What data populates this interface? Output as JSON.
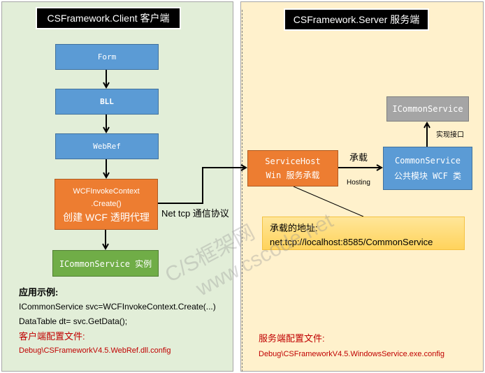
{
  "client": {
    "title": "CSFramework.Client 客户端",
    "boxes": {
      "form": "Form",
      "bll": "BLL",
      "webref": "WebRef",
      "wcf_line1": "WCFInvokeContext",
      "wcf_line2": ".Create()",
      "wcf_line3": "创建 WCF 透明代理",
      "instance": "ICommonService 实例"
    },
    "notes": {
      "heading": "应用示例:",
      "code_line1": "ICommonService svc=WCFInvokeContext.Create(...)",
      "code_line2": "DataTable dt= svc.GetData();",
      "config_heading": "客户端配置文件:",
      "config_path": "Debug\\CSFrameworkV4.5.WebRef.dll.config"
    }
  },
  "server": {
    "title": "CSFramework.Server 服务端",
    "boxes": {
      "servicehost_line1": "ServiceHost",
      "servicehost_line2": "Win 服务承载",
      "commonservice_line1": "CommonService",
      "commonservice_line2": "公共模块 WCF 类",
      "icommon": "ICommonService"
    },
    "address": {
      "heading": "承载的地址:",
      "url": "net.tcp://localhost:8585/CommonService"
    },
    "notes": {
      "config_heading": "服务端配置文件:",
      "config_path": "Debug\\CSFrameworkV4.5.WindowsService.exe.config"
    }
  },
  "connectors": {
    "protocol_label": "Net tcp 通信协议",
    "hosting_label_cn": "承载",
    "hosting_label_en": "Hosting",
    "implements_label": "实现接口"
  },
  "watermark": {
    "line1": "C/S框架网",
    "line2": "www.cscode.net"
  },
  "colors": {
    "client_bg": "#e2eed8",
    "server_bg": "#fff1cc",
    "blue_box": "#5b9bd5",
    "orange_box": "#ed7d31",
    "green_box": "#70ad47",
    "gray_box": "#a5a5a5",
    "config_text": "#c00000"
  }
}
